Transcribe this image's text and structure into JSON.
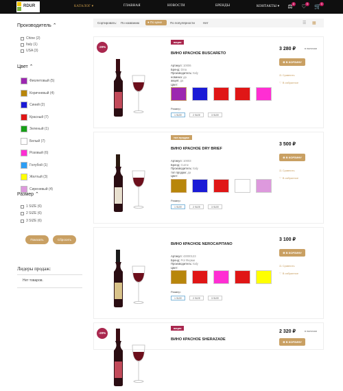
{
  "logo": {
    "text": "RDUR"
  },
  "nav": [
    {
      "label": "КАТАЛОГ ▾",
      "active": true
    },
    {
      "label": "ГЛАВНАЯ"
    },
    {
      "label": "НОВОСТИ"
    },
    {
      "label": "БРЕНДЫ"
    },
    {
      "label": "КОНТАКТЫ ▾"
    }
  ],
  "top_icons": {
    "compare_count": "0",
    "wishlist_count": "0",
    "cart_count": "0"
  },
  "filters": {
    "manufacturer": {
      "title": "Производитель ⌃",
      "items": [
        "Chine (2)",
        "Italy (1)",
        "USA (3)"
      ]
    },
    "color": {
      "title": "Цвет ⌃",
      "items": [
        {
          "label": "Фиолетовый (5)",
          "hex": "#9c27b0"
        },
        {
          "label": "Коричневый (4)",
          "hex": "#b8860b"
        },
        {
          "label": "Синий (2)",
          "hex": "#1a1ad6"
        },
        {
          "label": "Красный (7)",
          "hex": "#e01616"
        },
        {
          "label": "Зеленый (1)",
          "hex": "#18a018"
        },
        {
          "label": "Белый (7)",
          "hex": "#ffffff"
        },
        {
          "label": "Розовый (6)",
          "hex": "#ff2ed3"
        },
        {
          "label": "Голубой (1)",
          "hex": "#2d9ef5"
        },
        {
          "label": "Желтый (3)",
          "hex": "#ffff00"
        },
        {
          "label": "Сиреневый (4)",
          "hex": "#dd99dd"
        }
      ]
    },
    "size": {
      "title": "Размер ⌃",
      "items": [
        "1 SIZE (6)",
        "2 SIZE (6)",
        "3 SIZE (6)"
      ]
    },
    "show_label": "Показать",
    "reset_label": "Сбросить"
  },
  "leaders": {
    "title": "Лидеры продаж:",
    "empty": "Нет товаров."
  },
  "sortbar": {
    "label": "Сортировать:",
    "by_name": "По названию",
    "by_price": "По цене",
    "by_popularity": "По популярности",
    "no": "Нет"
  },
  "products": [
    {
      "discount": "-20%",
      "tag": "акция",
      "tag_color": "#a9274e",
      "title": "ВИНО КРАСНОЕ BUSCARETO",
      "attrs": [
        {
          "k": "Артикул:",
          "v": "10006"
        },
        {
          "k": "Бренд:",
          "v": "Dina"
        },
        {
          "k": "Производитель:",
          "v": "Italy"
        },
        {
          "k": "новинка:",
          "v": "да"
        },
        {
          "k": "акция:",
          "v": "да"
        },
        {
          "k": "Цвет:",
          "v": ""
        }
      ],
      "colors": [
        "#9c27b0",
        "#1a1ad6",
        "#e01616",
        "#e01616",
        "#ff2ed3"
      ],
      "size_label": "Размер:",
      "sizes": [
        "1 SIZE",
        "2 SIZE",
        "3 SIZE"
      ],
      "price": "3 280 ₽",
      "stock": "в наличии",
      "cart": "В КОРЗИНУ",
      "compare": "Сравнить",
      "wish": "В избранное"
    },
    {
      "tag": "топ продаж",
      "tag_color": "#c9a063",
      "title": "ВИНО КРАСНОЕ DRY BRIEF",
      "attrs": [
        {
          "k": "Артикул:",
          "v": "10003"
        },
        {
          "k": "Бренд:",
          "v": "Curne"
        },
        {
          "k": "Производитель:",
          "v": "Italy"
        },
        {
          "k": "топ продаж:",
          "v": "да"
        },
        {
          "k": "Цвет:",
          "v": ""
        }
      ],
      "colors": [
        "#b8860b",
        "#1a1ad6",
        "#e01616",
        "#ffffff",
        "#dd99dd"
      ],
      "size_label": "Размер:",
      "sizes": [
        "1 SIZE",
        "2 SIZE",
        "3 SIZE"
      ],
      "price": "3 500 ₽",
      "cart": "В КОРЗИНУ",
      "compare": "Сравнить",
      "wish": "В избранное"
    },
    {
      "title": "ВИНО КРАСНОЕ NEROCAPITANO",
      "attrs": [
        {
          "k": "Артикул:",
          "v": "43000123"
        },
        {
          "k": "Бренд:",
          "v": "Pot Ферми"
        },
        {
          "k": "Производитель:",
          "v": "Italy"
        },
        {
          "k": "Цвет:",
          "v": ""
        }
      ],
      "colors": [
        "#b8860b",
        "#e01616",
        "#ff2ed3",
        "#e01616",
        "#ffff00"
      ],
      "size_label": "Размер:",
      "sizes": [
        "1 SIZE",
        "2 SIZE",
        "3 SIZE"
      ],
      "price": "3 100 ₽",
      "cart": "В КОРЗИНУ",
      "compare": "Сравнить",
      "wish": "В избранное"
    },
    {
      "discount": "-20%",
      "tag": "акция",
      "tag_color": "#a9274e",
      "title": "ВИНО КРАСНОЕ SHERAZADE",
      "price": "2 320 ₽",
      "stock": "в наличии",
      "cart": "В КОРЗИНУ"
    }
  ]
}
